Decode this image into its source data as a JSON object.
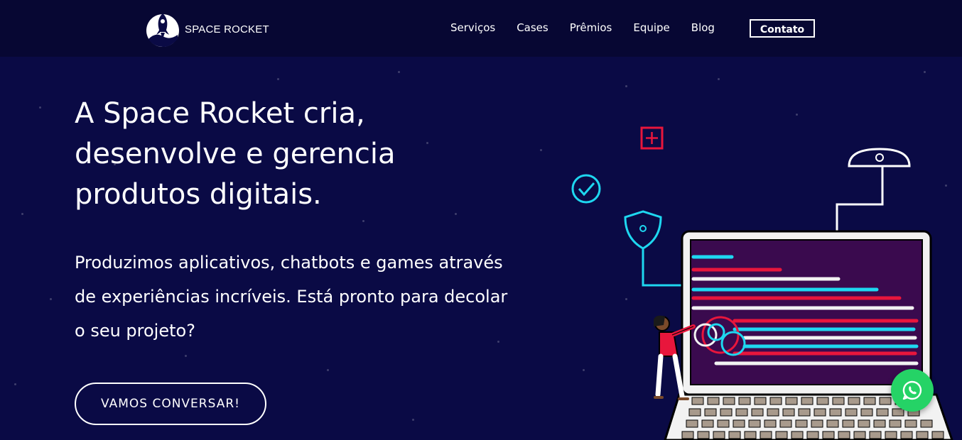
{
  "brand": {
    "name": "SPACE ROCKET"
  },
  "nav": {
    "items": [
      {
        "label": "Serviços"
      },
      {
        "label": "Cases"
      },
      {
        "label": "Prêmios"
      },
      {
        "label": "Equipe"
      },
      {
        "label": "Blog"
      }
    ],
    "contact_label": "Contato"
  },
  "hero": {
    "headline": "A Space Rocket cria, desenvolve e gerencia produtos digitais.",
    "subtitle": "Produzimos aplicativos, chatbots e games através de experiências incríveis. Está pronto para decolar o seu projeto?",
    "cta_label": "VAMOS CONVERSAR!"
  },
  "colors": {
    "background": "#0a0a45",
    "header": "#070733",
    "accent_red": "#e8163c",
    "accent_cyan": "#1ed7f0",
    "whatsapp": "#25d366"
  },
  "icons": {
    "logo": "rocket-logo-icon",
    "whatsapp": "whatsapp-icon"
  }
}
